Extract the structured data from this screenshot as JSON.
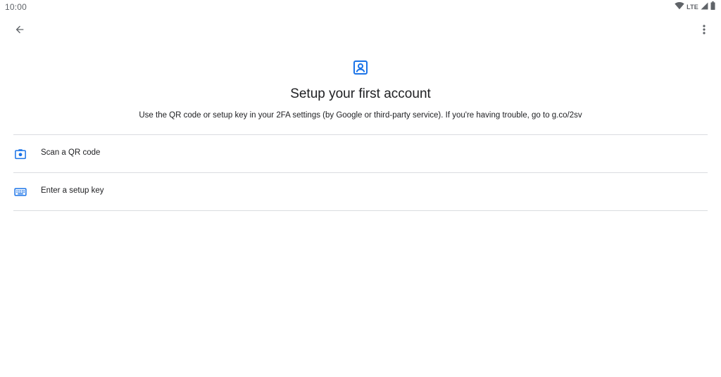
{
  "status_bar": {
    "time": "10:00",
    "network": "LTE",
    "icons": [
      "wifi-icon",
      "cell-signal-icon",
      "battery-icon"
    ]
  },
  "app_bar": {
    "back_icon": "arrow-back-icon",
    "menu_icon": "more-vert-icon"
  },
  "header": {
    "icon": "account-box-icon",
    "title": "Setup your first account",
    "subtitle": "Use the QR code or setup key in your 2FA settings (by Google or third-party service). If you're having trouble, go to g.co/2sv"
  },
  "options": [
    {
      "icon": "camera-icon",
      "label": "Scan a QR code"
    },
    {
      "icon": "keyboard-icon",
      "label": "Enter a setup key"
    }
  ],
  "colors": {
    "accent": "#1a73e8",
    "text": "#202124",
    "secondary": "#5f6368",
    "divider": "#dadce0"
  }
}
